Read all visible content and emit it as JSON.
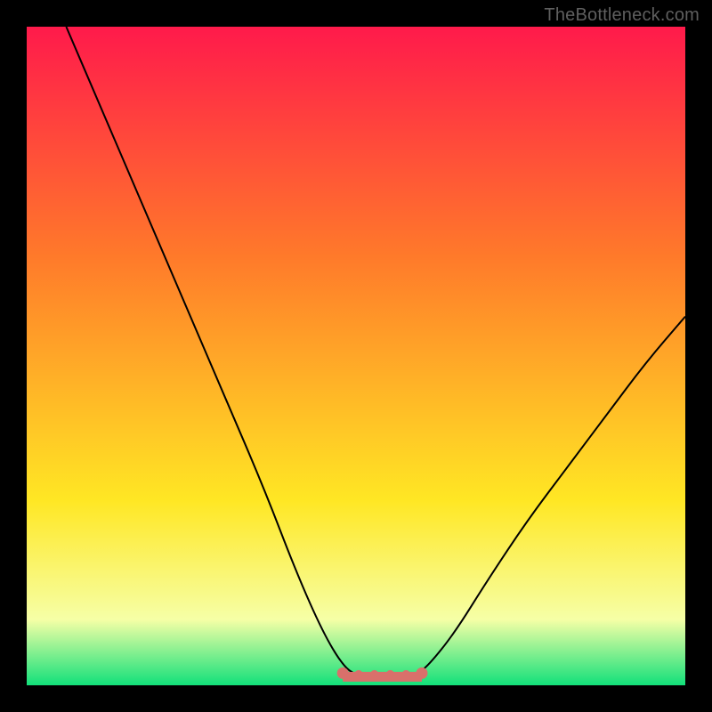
{
  "watermark": "TheBottleneck.com",
  "chart_data": {
    "type": "line",
    "title": "",
    "xlabel": "",
    "ylabel": "",
    "xlim": [
      0,
      100
    ],
    "ylim": [
      0,
      100
    ],
    "grid": false,
    "legend": false,
    "curve": {
      "name": "bottleneck-curve",
      "color": "#000000",
      "points": [
        {
          "x": 6,
          "y": 100
        },
        {
          "x": 12,
          "y": 86
        },
        {
          "x": 18,
          "y": 72
        },
        {
          "x": 24,
          "y": 58
        },
        {
          "x": 30,
          "y": 44
        },
        {
          "x": 36,
          "y": 30
        },
        {
          "x": 41,
          "y": 17
        },
        {
          "x": 45,
          "y": 8
        },
        {
          "x": 48,
          "y": 3
        },
        {
          "x": 50,
          "y": 1.5
        },
        {
          "x": 53,
          "y": 1.2
        },
        {
          "x": 56,
          "y": 1.2
        },
        {
          "x": 59,
          "y": 1.5
        },
        {
          "x": 61,
          "y": 3
        },
        {
          "x": 65,
          "y": 8
        },
        {
          "x": 70,
          "y": 16
        },
        {
          "x": 76,
          "y": 25
        },
        {
          "x": 82,
          "y": 33
        },
        {
          "x": 88,
          "y": 41
        },
        {
          "x": 94,
          "y": 49
        },
        {
          "x": 100,
          "y": 56
        }
      ]
    },
    "flat_region": {
      "name": "optimal-band",
      "color": "#d9706b",
      "x_start": 48,
      "x_end": 60,
      "y": 1.3
    },
    "background_gradient": {
      "top": "#ff1a4b",
      "mid1": "#ff7a2a",
      "mid2": "#ffe724",
      "band": "#f6ffa6",
      "bottom": "#12e07a"
    }
  }
}
